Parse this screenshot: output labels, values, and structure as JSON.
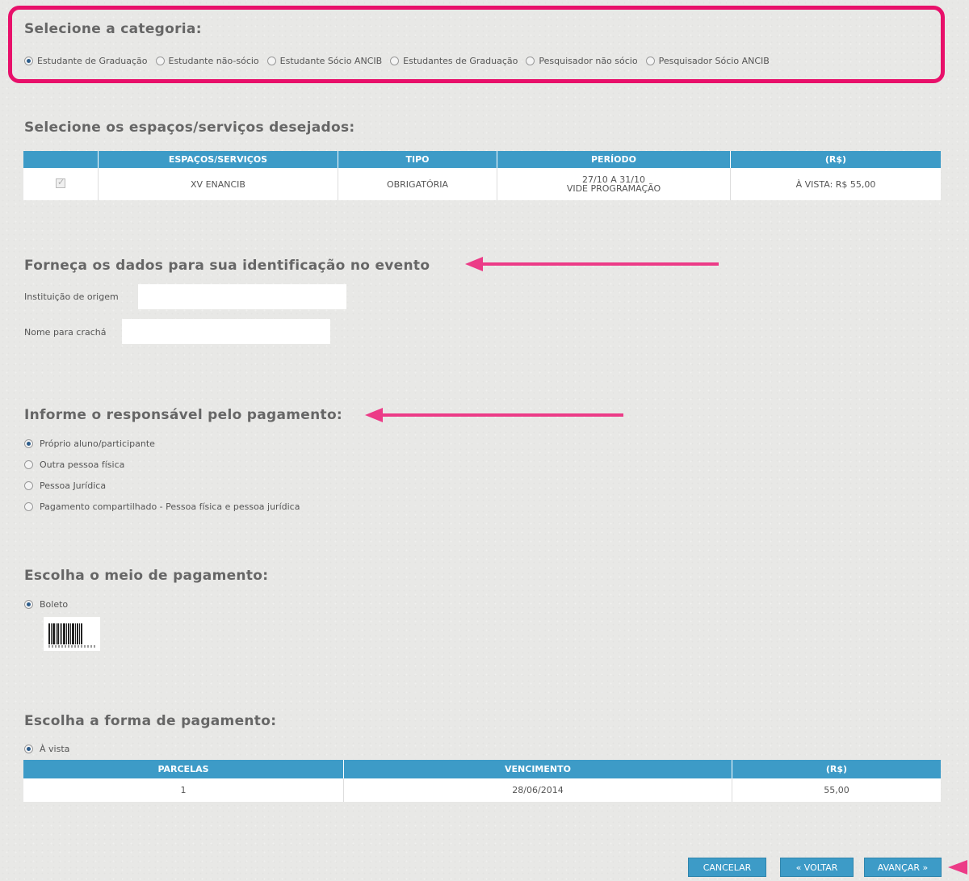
{
  "category": {
    "title": "Selecione a categoria:",
    "options": [
      {
        "label": "Estudante de Graduação",
        "checked": true
      },
      {
        "label": "Estudante não-sócio",
        "checked": false
      },
      {
        "label": "Estudante Sócio ANCIB",
        "checked": false
      },
      {
        "label": "Estudantes de Graduação",
        "checked": false
      },
      {
        "label": "Pesquisador não sócio",
        "checked": false
      },
      {
        "label": "Pesquisador Sócio ANCIB",
        "checked": false
      }
    ]
  },
  "services": {
    "title": "Selecione os espaços/serviços desejados:",
    "headers": [
      "ESPAÇOS/SERVIÇOS",
      "TIPO",
      "PERÍODO",
      "(R$)"
    ],
    "rows": [
      {
        "checked": true,
        "name": "XV ENANCIB",
        "type": "OBRIGATÓRIA",
        "period_line1": "27/10 A 31/10",
        "period_line2": "VIDE PROGRAMAÇÃO",
        "price": "À VISTA: R$ 55,00"
      }
    ]
  },
  "identification": {
    "title": "Forneça os dados para sua identificação no evento",
    "institution_label": "Instituição de origem",
    "institution_value": "",
    "badge_label": "Nome para crachá",
    "badge_value": ""
  },
  "payer": {
    "title": "Informe o responsável pelo pagamento:",
    "options": [
      {
        "label": "Próprio aluno/participante",
        "checked": true
      },
      {
        "label": "Outra pessoa física",
        "checked": false
      },
      {
        "label": "Pessoa Jurídica",
        "checked": false
      },
      {
        "label": "Pagamento compartilhado - Pessoa física e pessoa jurídica",
        "checked": false
      }
    ]
  },
  "payment_method": {
    "title": "Escolha o meio de pagamento:",
    "option": {
      "label": "Boleto",
      "checked": true
    },
    "barcode_icon": "barcode-icon"
  },
  "payment_form": {
    "title": "Escolha a forma de pagamento:",
    "option": {
      "label": "À vista",
      "checked": true
    },
    "headers": [
      "PARCELAS",
      "VENCIMENTO",
      "(R$)"
    ],
    "rows": [
      {
        "installment": "1",
        "due": "28/06/2014",
        "value": "55,00"
      }
    ]
  },
  "buttons": {
    "cancel": "CANCELAR",
    "back": "« VOLTAR",
    "next": "AVANÇAR »"
  },
  "colors": {
    "accent": "#3d9bc7",
    "highlight": "#e8106a"
  }
}
